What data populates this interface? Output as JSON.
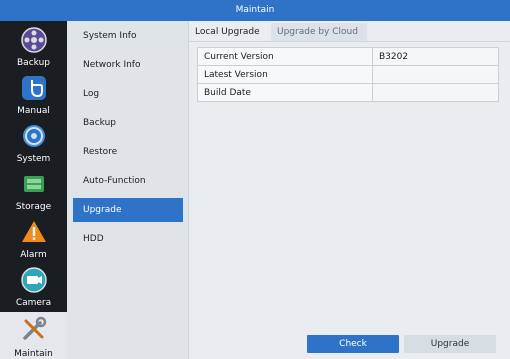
{
  "window": {
    "title": "Maintain"
  },
  "iconbar": {
    "items": [
      {
        "label": "Backup",
        "icon": "film-reel-icon"
      },
      {
        "label": "Manual",
        "icon": "hand-pointer-icon"
      },
      {
        "label": "System",
        "icon": "gear-icon"
      },
      {
        "label": "Storage",
        "icon": "hard-drive-icon"
      },
      {
        "label": "Alarm",
        "icon": "warning-icon"
      },
      {
        "label": "Camera",
        "icon": "camera-icon"
      },
      {
        "label": "Maintain",
        "icon": "tools-icon",
        "active": true
      }
    ]
  },
  "menu": {
    "items": [
      {
        "label": "System Info"
      },
      {
        "label": "Network Info"
      },
      {
        "label": "Log"
      },
      {
        "label": "Backup"
      },
      {
        "label": "Restore"
      },
      {
        "label": "Auto-Function"
      },
      {
        "label": "Upgrade",
        "active": true
      },
      {
        "label": "HDD"
      }
    ]
  },
  "tabs": [
    {
      "label": "Local Upgrade"
    },
    {
      "label": "Upgrade by Cloud"
    }
  ],
  "info": {
    "rows": [
      {
        "label": "Current Version",
        "value": "B3202"
      },
      {
        "label": "Latest Version",
        "value": ""
      },
      {
        "label": "Build Date",
        "value": ""
      }
    ]
  },
  "buttons": {
    "check": "Check",
    "upgrade": "Upgrade"
  },
  "colors": {
    "accent": "#2f73c8",
    "sidebar": "#1a1d22"
  }
}
